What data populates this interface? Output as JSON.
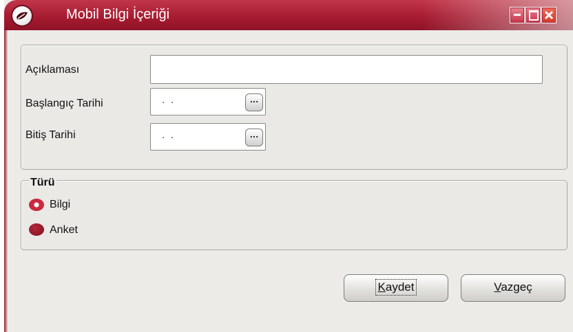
{
  "window": {
    "title": "Mobil Bilgi İçeriği",
    "app_icon": "leaf-logo-icon",
    "controls": {
      "minimize": "minimize-icon",
      "maximize": "maximize-icon",
      "close": "close-icon"
    }
  },
  "form": {
    "description_label": "Açıklaması",
    "description_value": "",
    "start_date_label": "Başlangıç Tarihi",
    "start_date_value": ". .",
    "end_date_label": "Bitiş Tarihi",
    "end_date_value": ". .",
    "date_picker_button": "..."
  },
  "type_group": {
    "title": "Türü",
    "options": [
      {
        "label": "Bilgi",
        "selected": true
      },
      {
        "label": "Anket",
        "selected": false
      }
    ]
  },
  "buttons": {
    "save": {
      "accel": "K",
      "rest": "aydet"
    },
    "cancel": {
      "accel": "V",
      "rest": "azgeç"
    }
  },
  "colors": {
    "title_bar": "#a71c31",
    "radio_accent": "#c92a3d",
    "background": "#ecebe8"
  }
}
